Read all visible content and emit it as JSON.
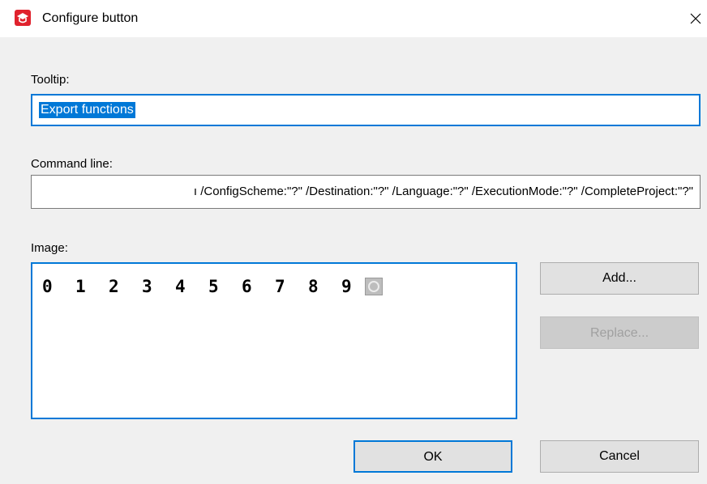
{
  "window": {
    "title": "Configure button",
    "close_glyph": "✕"
  },
  "tooltip": {
    "label": "Tooltip:",
    "value": "Export functions"
  },
  "command_line": {
    "label": "Command line:",
    "value": "ı /ConfigScheme:\"?\" /Destination:\"?\" /Language:\"?\" /ExecutionMode:\"?\" /CompleteProject:\"?\""
  },
  "image": {
    "label": "Image:",
    "items": [
      "0",
      "1",
      "2",
      "3",
      "4",
      "5",
      "6",
      "7",
      "8",
      "9"
    ]
  },
  "buttons": {
    "add": "Add...",
    "replace": "Replace...",
    "ok": "OK",
    "cancel": "Cancel"
  },
  "colors": {
    "accent": "#0078d7",
    "app_icon": "#e0222d",
    "dialog_bg": "#f0f0f0",
    "button_bg": "#e1e1e1"
  }
}
